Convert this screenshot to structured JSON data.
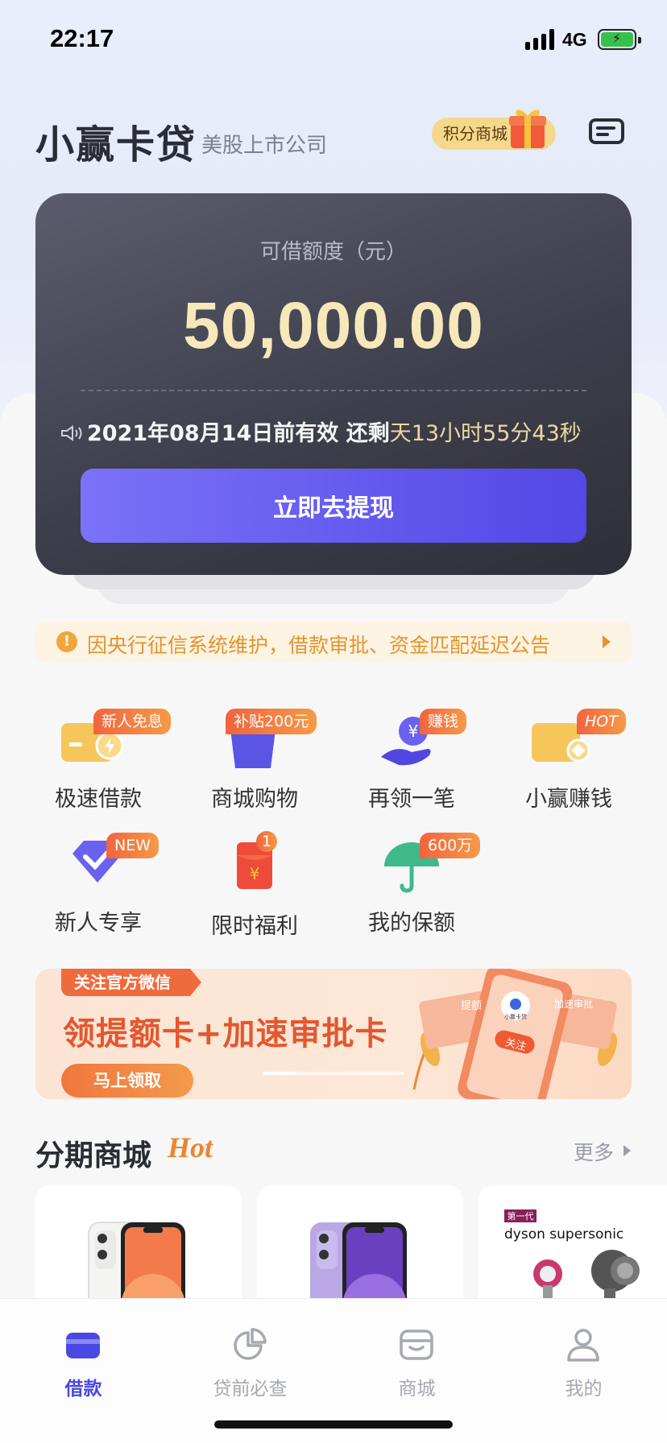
{
  "status": {
    "time": "22:17",
    "network": "4G"
  },
  "header": {
    "title": "小赢卡贷",
    "subtitle": "美股上市公司",
    "points_mall": "积分商城"
  },
  "card": {
    "label": "可借额度（元）",
    "amount": "50,000.00",
    "valid_prefix": "2021年08月14日前有效 还剩",
    "valid_countdown": "天13小时55分43秒",
    "button": "立即去提现"
  },
  "notice": {
    "text": "因央行征信系统维护，借款审批、资金匹配延迟公告"
  },
  "grid": [
    {
      "label": "极速借款",
      "badge": "新人免息"
    },
    {
      "label": "商城购物",
      "badge": "补贴200元"
    },
    {
      "label": "再领一笔",
      "badge": "赚钱"
    },
    {
      "label": "小赢赚钱",
      "badge": "HOT"
    },
    {
      "label": "新人专享",
      "badge": "NEW"
    },
    {
      "label": "限时福利",
      "badge": "1"
    },
    {
      "label": "我的保额",
      "badge": "600万"
    }
  ],
  "banner": {
    "tag": "关注官方微信",
    "title": "领提额卡+加速审批卡",
    "button": "马上领取",
    "art_left": "提额",
    "art_right": "加速审批",
    "art_center": "关注",
    "art_logo": "小赢卡贷"
  },
  "mall": {
    "title": "分期商城",
    "hot": "Hot",
    "more": "更多",
    "products": [
      {
        "name": "iPhone 12 White"
      },
      {
        "name": "iPhone 12 Purple"
      },
      {
        "tag": "第一代",
        "brand": "dyson supersonic"
      }
    ]
  },
  "tabs": [
    {
      "label": "借款",
      "active": true
    },
    {
      "label": "贷前必查",
      "active": false
    },
    {
      "label": "商城",
      "active": false
    },
    {
      "label": "我的",
      "active": false
    }
  ],
  "colors": {
    "accent": "#4a48e2",
    "gold": "#f6e8b8",
    "orange": "#f0832e",
    "card_bg": "#3e3f4c"
  }
}
